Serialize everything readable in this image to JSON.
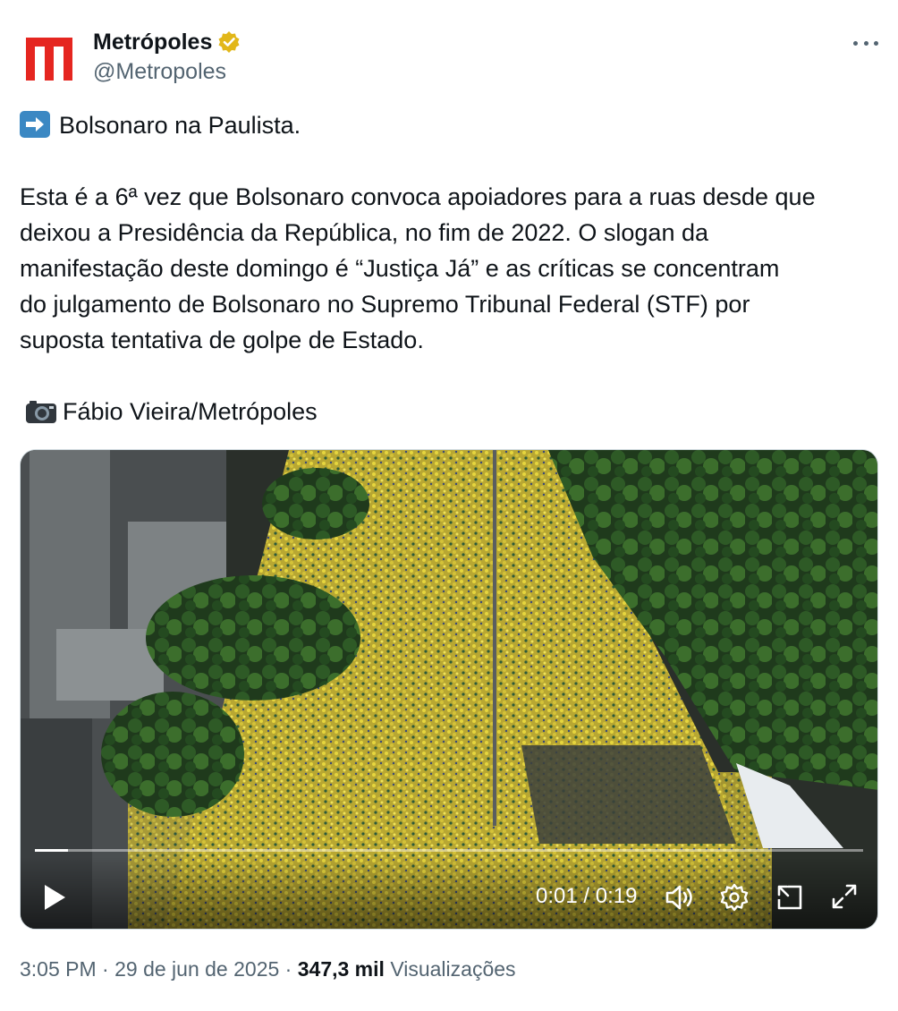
{
  "author": {
    "display_name": "Metrópoles",
    "handle": "@Metropoles",
    "verified": true,
    "verified_color": "#e2b719",
    "logo_color": "#e52620"
  },
  "tweet": {
    "title_icon": "arrow-right-emoji",
    "title": "Bolsonaro na Paulista.",
    "body_lines": [
      "Esta é a 6ª vez que Bolsonaro convoca apoiadores para a ruas desde que",
      "deixou a Presidência da República, no fim de 2022. O slogan da",
      "manifestação deste domingo é “Justiça Já” e as críticas se concentram",
      "do julgamento de Bolsonaro no Supremo Tribunal Federal (STF) por",
      "suposta tentativa de golpe de Estado."
    ],
    "credit_icon": "camera-emoji",
    "credit": "Fábio Vieira/Metrópoles"
  },
  "video": {
    "time_display": "0:01 / 0:19",
    "progress_fraction": 0.04,
    "icons": [
      "play-icon",
      "volume-icon",
      "settings-icon",
      "pip-icon",
      "fullscreen-icon"
    ]
  },
  "footer": {
    "time": "3:05 PM",
    "separator": "·",
    "date": "29 de jun de 2025",
    "views_count": "347,3 mil",
    "views_label": "Visualizações"
  },
  "colors": {
    "text": "#0f1419",
    "secondary": "#536471",
    "arrow_emoji_bg": "#3b88c3"
  }
}
